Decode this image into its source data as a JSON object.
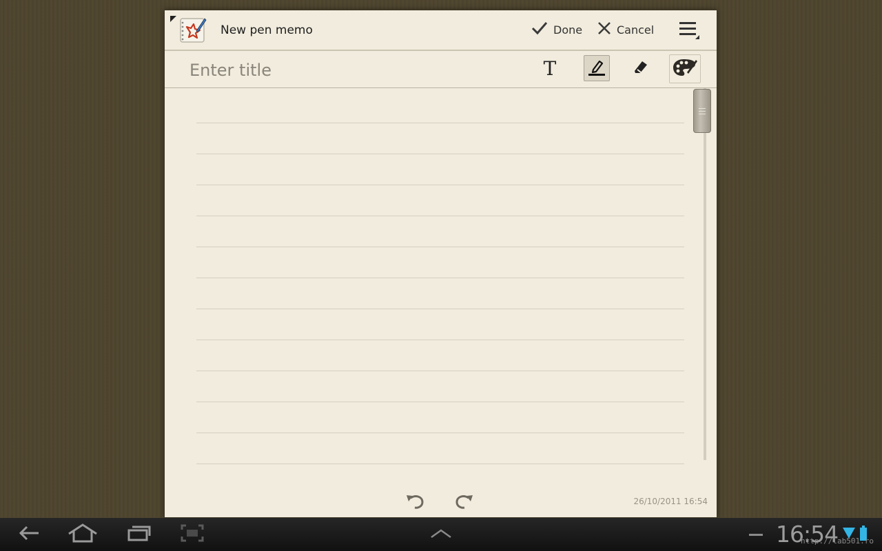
{
  "header": {
    "title": "New pen memo",
    "done_label": "Done",
    "cancel_label": "Cancel"
  },
  "toolbar": {
    "title_placeholder": "Enter title",
    "text_tool_label": "T",
    "active_tool": "pen"
  },
  "memo": {
    "timestamp": "26/10/2011 16:54"
  },
  "status_bar": {
    "time": "16:54",
    "watermark": "http://lab501.ro"
  },
  "icons": {
    "app": "pen-memo-app-icon",
    "done": "check-icon",
    "cancel": "close-icon",
    "menu": "menu-icon",
    "text": "text-icon",
    "pen": "pen-icon",
    "eraser": "eraser-icon",
    "palette": "palette-icon",
    "undo": "undo-icon",
    "redo": "redo-icon",
    "back": "back-icon",
    "home": "home-icon",
    "recent": "recent-apps-icon",
    "screenshot": "screenshot-icon",
    "up": "chevron-up-icon",
    "wifi": "wifi-icon",
    "battery": "battery-icon"
  },
  "colors": {
    "paper": "#f1ecdd",
    "desk": "#4e4530",
    "accent_wifi": "#33b5e5"
  }
}
